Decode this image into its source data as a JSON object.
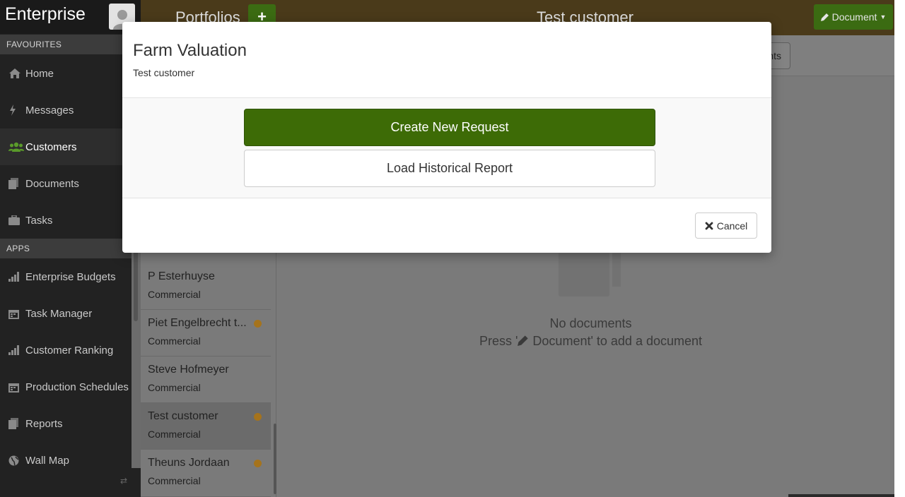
{
  "app": {
    "title": "Enterprise"
  },
  "sidebar": {
    "favourites_header": "FAVOURITES",
    "apps_header": "APPS",
    "favourites": [
      {
        "label": "Home",
        "icon": "home-icon"
      },
      {
        "label": "Messages",
        "icon": "bolt-icon"
      },
      {
        "label": "Customers",
        "icon": "users-icon",
        "active": true
      },
      {
        "label": "Documents",
        "icon": "document-icon"
      },
      {
        "label": "Tasks",
        "icon": "briefcase-icon"
      }
    ],
    "apps": [
      {
        "label": "Enterprise Budgets",
        "icon": "bar-chart-icon"
      },
      {
        "label": "Task Manager",
        "icon": "calendar-icon"
      },
      {
        "label": "Customer Ranking",
        "icon": "bar-chart-icon"
      },
      {
        "label": "Production Schedules",
        "icon": "calendar-icon"
      },
      {
        "label": "Reports",
        "icon": "document-icon"
      },
      {
        "label": "Wall Map",
        "icon": "globe-icon"
      }
    ]
  },
  "topbar": {
    "portfolios_label": "Portfolios",
    "add_label": "+",
    "customer_title": "Test customer",
    "document_button": "Document"
  },
  "subbar": {
    "button_label": "nts"
  },
  "customers": {
    "partial_type": "Commercial",
    "items": [
      {
        "name": "P Esterhuyse",
        "type": "Commercial",
        "dot": false
      },
      {
        "name": "Piet Engelbrecht t...",
        "type": "Commercial",
        "dot": true
      },
      {
        "name": "Steve Hofmeyer",
        "type": "Commercial",
        "dot": false
      },
      {
        "name": "Test customer",
        "type": "Commercial",
        "dot": true,
        "selected": true
      },
      {
        "name": "Theuns Jordaan",
        "type": "Commercial",
        "dot": true
      }
    ]
  },
  "empty_state": {
    "title": "No documents",
    "hint_prefix": "Press '",
    "hint_suffix": " Document' to add a document"
  },
  "modal": {
    "title": "Farm Valuation",
    "subtitle": "Test customer",
    "primary_button": "Create New Request",
    "secondary_button": "Load Historical Report",
    "cancel_button": "Cancel"
  },
  "colors": {
    "brand_green": "#3d6b06",
    "status_dot": "#a5731c"
  }
}
